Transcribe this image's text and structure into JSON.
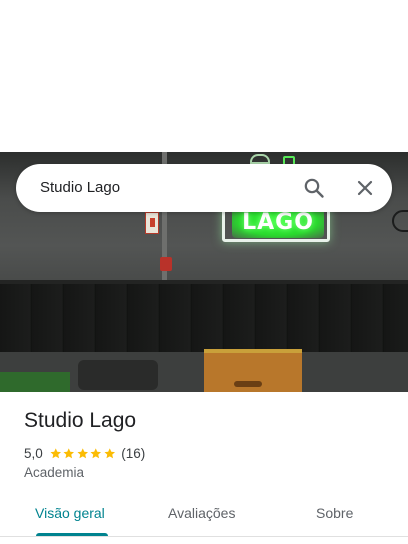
{
  "search": {
    "query": "Studio Lago"
  },
  "hero": {
    "sign_text": "LAGO"
  },
  "place": {
    "name": "Studio Lago",
    "rating": "5,0",
    "stars": 5,
    "review_count": "(16)",
    "category": "Academia"
  },
  "tabs": [
    {
      "label": "Visão geral",
      "active": true
    },
    {
      "label": "Avaliações",
      "active": false
    },
    {
      "label": "Sobre",
      "active": false
    }
  ],
  "colors": {
    "accent": "#00838f",
    "star": "#fbbc04",
    "neon": "#36ff3a"
  }
}
